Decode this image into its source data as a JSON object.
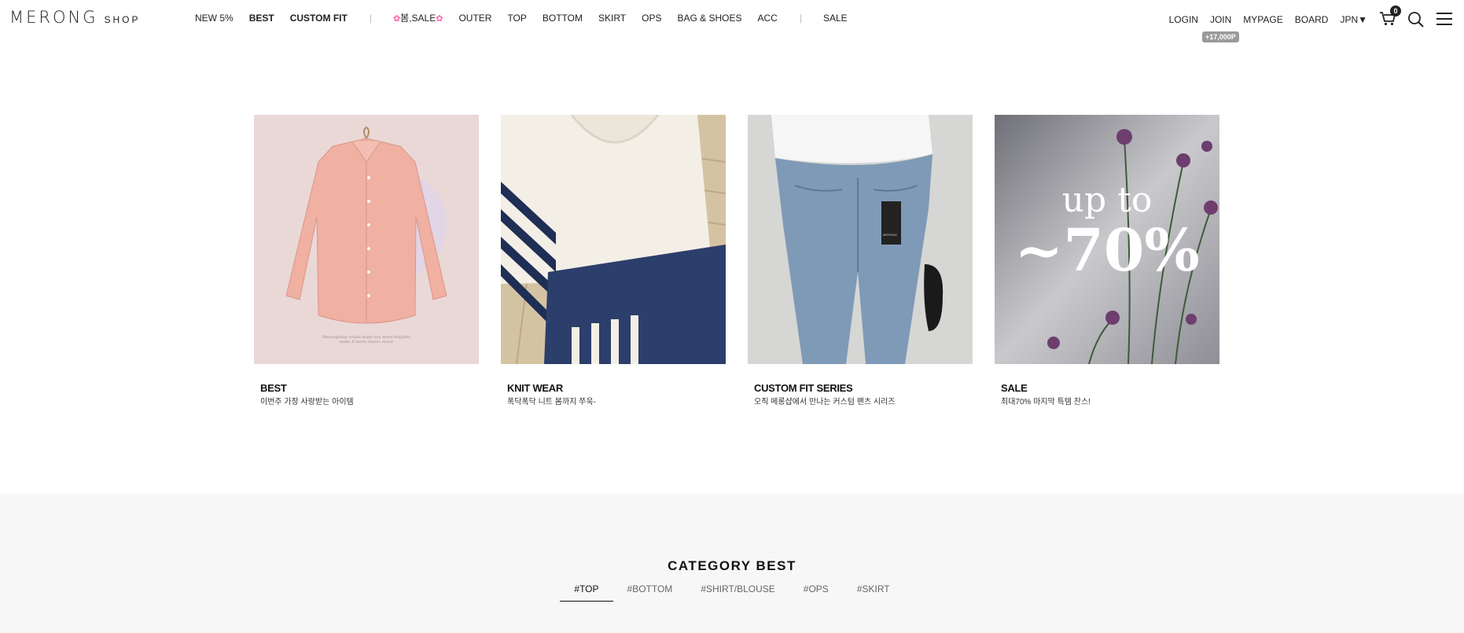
{
  "logo": {
    "main": "MERONG",
    "sub": "SHOP"
  },
  "nav": {
    "new": "NEW 5%",
    "best": "BEST",
    "custom_fit": "CUSTOM FIT",
    "separator": "|",
    "spring_sale_flower": "✿",
    "spring_sale": "봄,SALE",
    "outer": "OUTER",
    "top": "TOP",
    "bottom": "BOTTOM",
    "skirt": "SKIRT",
    "ops": "OPS",
    "bag_shoes": "BAG & SHOES",
    "acc": "ACC",
    "sale": "SALE"
  },
  "util": {
    "login": "LOGIN",
    "join": "JOIN",
    "join_badge": "+17,000P",
    "mypage": "MYPAGE",
    "board": "BOARD",
    "language": "JPN▼",
    "cart_count": "0",
    "icons": [
      "cart-icon",
      "search-icon",
      "menu-icon"
    ]
  },
  "banners": [
    {
      "title": "BEST",
      "subtitle": "이번주 가장 사랑받는 아이템",
      "image_caption_1": "Merongshop would make you more brighter",
      "image_caption_2": "make it more classic mood"
    },
    {
      "title": "KNIT WEAR",
      "subtitle": "폭닥폭닥 니트 봄까지 쭈욱-"
    },
    {
      "title": "CUSTOM FIT SERIES",
      "subtitle": "오직 메롱샵에서 만나는 커스텀 팬츠 시리즈",
      "tag_text": "MERONG"
    },
    {
      "title": "SALE",
      "subtitle": "최대70% 마지막 특템 찬스!",
      "overlay_line1": "up to",
      "overlay_line2": "~70%"
    }
  ],
  "category": {
    "title": "CATEGORY BEST",
    "tabs": [
      "#TOP",
      "#BOTTOM",
      "#SHIRT/BLOUSE",
      "#OPS",
      "#SKIRT"
    ],
    "active_tab": "#TOP"
  },
  "colors": {
    "badge": "#9a9a9a",
    "flower": "#ff5fa8",
    "section_bg": "#f7f7f7"
  }
}
